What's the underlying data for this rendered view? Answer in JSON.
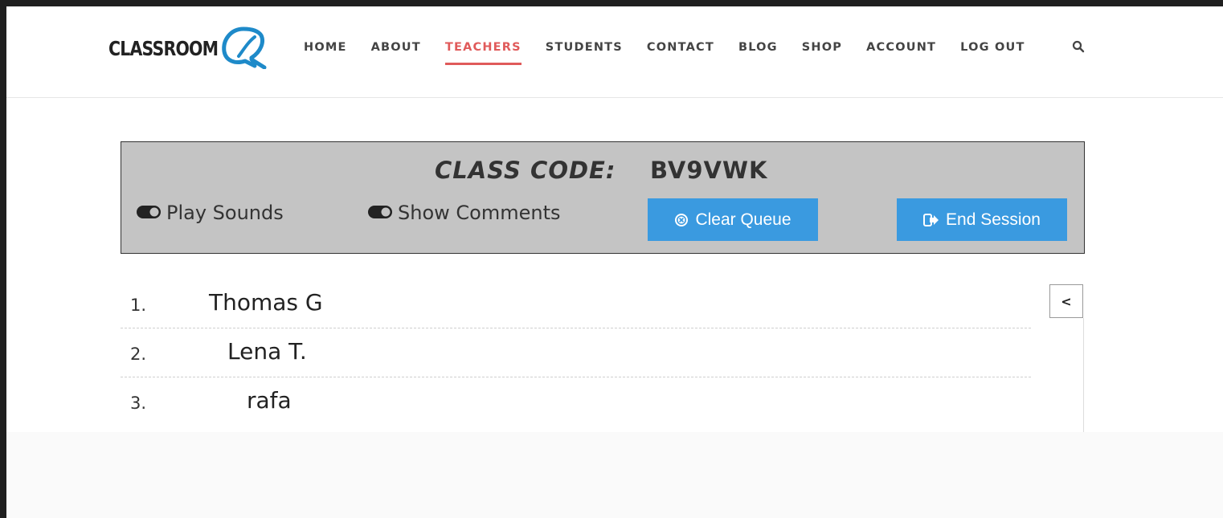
{
  "brand": {
    "logo_text": "CLASSROOM",
    "logo_mark": "Q-logo-icon",
    "accent_color": "#1e8ac9"
  },
  "nav": {
    "items": [
      {
        "label": "HOME",
        "active": false
      },
      {
        "label": "ABOUT",
        "active": false
      },
      {
        "label": "TEACHERS",
        "active": true
      },
      {
        "label": "STUDENTS",
        "active": false
      },
      {
        "label": "CONTACT",
        "active": false
      },
      {
        "label": "BLOG",
        "active": false
      },
      {
        "label": "SHOP",
        "active": false
      },
      {
        "label": "ACCOUNT",
        "active": false
      },
      {
        "label": "LOG OUT",
        "active": false
      }
    ],
    "active_color": "#e05a5a",
    "search_icon": "search-icon"
  },
  "panel": {
    "code_label": "CLASS CODE:",
    "code_value": "BV9VWK",
    "toggles": [
      {
        "label": "Play Sounds",
        "icon": "toggle-icon"
      },
      {
        "label": "Show Comments",
        "icon": "toggle-icon"
      }
    ],
    "clear_button": {
      "label": "Clear Queue",
      "icon": "circle-x-icon"
    },
    "end_button": {
      "label": "End Session",
      "icon": "sign-out-icon"
    },
    "button_color": "#3a9ae0"
  },
  "queue": {
    "items": [
      {
        "number": "1.",
        "name": "Thomas G"
      },
      {
        "number": "2.",
        "name": "Lena T."
      },
      {
        "number": "3.",
        "name": "rafa"
      }
    ],
    "collapse_label": "<"
  }
}
